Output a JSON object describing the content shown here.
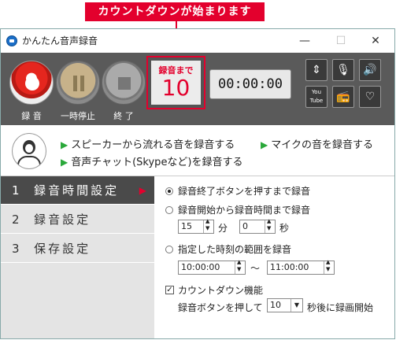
{
  "callout": {
    "text": "カウントダウンが始まります"
  },
  "window": {
    "title": "かんたん音声録音",
    "min": "—",
    "max": "☐",
    "close": "✕"
  },
  "toolbar": {
    "record_label": "録 音",
    "pause_label": "一時停止",
    "stop_label": "終 了",
    "countdown_label": "録音まで",
    "countdown_value": "10",
    "timer": "00:00:00",
    "icons": [
      "window-icon",
      "microphone-icon",
      "speaker-icon",
      "youtube-icon",
      "radio-icon",
      "heart-icon"
    ],
    "youtube_text": "You Tube"
  },
  "sources": {
    "speaker": "スピーカーから流れる音を録音する",
    "mic": "マイクの音を録音する",
    "chat": "音声チャット(Skypeなど)を録音する"
  },
  "sidebar": {
    "items": [
      {
        "num": "1",
        "label": "録音時間設定"
      },
      {
        "num": "2",
        "label": "録音設定"
      },
      {
        "num": "3",
        "label": "保存設定"
      }
    ]
  },
  "settings": {
    "opt1": "録音終了ボタンを押すまで録音",
    "opt2": "録音開始から録音時間まで録音",
    "minutes": "15",
    "minutes_unit": "分",
    "seconds": "0",
    "seconds_unit": "秒",
    "opt3": "指定した時刻の範囲を録音",
    "time_from": "10:00:00",
    "tilde": "〜",
    "time_to": "11:00:00",
    "countdown_check": "カウントダウン機能",
    "countdown_prefix": "録音ボタンを押して",
    "countdown_sec": "10",
    "countdown_suffix": "秒後に録画開始"
  },
  "colors": {
    "accent_red": "#e3002d",
    "toolbar_bg": "#5a5a5a",
    "green": "#2aa83a"
  }
}
